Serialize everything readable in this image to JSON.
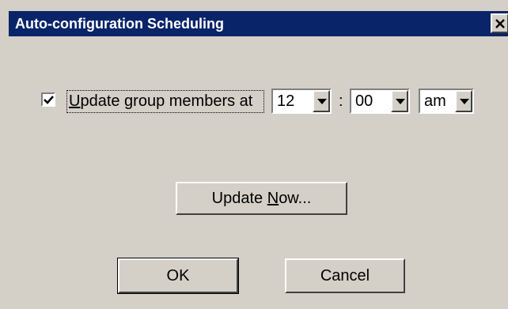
{
  "dialog": {
    "title": "Auto-configuration Scheduling"
  },
  "schedule": {
    "checked": true,
    "label_mnemonic": "U",
    "label_rest": "pdate group members at",
    "hour": "12",
    "separator": ":",
    "minute": "00",
    "ampm": "am"
  },
  "buttons": {
    "update_now_pre": "Update ",
    "update_now_mnemonic": "N",
    "update_now_post": "ow...",
    "ok": "OK",
    "cancel": "Cancel"
  },
  "icons": {
    "close": "close-icon",
    "check": "checkmark-icon",
    "dropdown": "chevron-down-icon"
  }
}
